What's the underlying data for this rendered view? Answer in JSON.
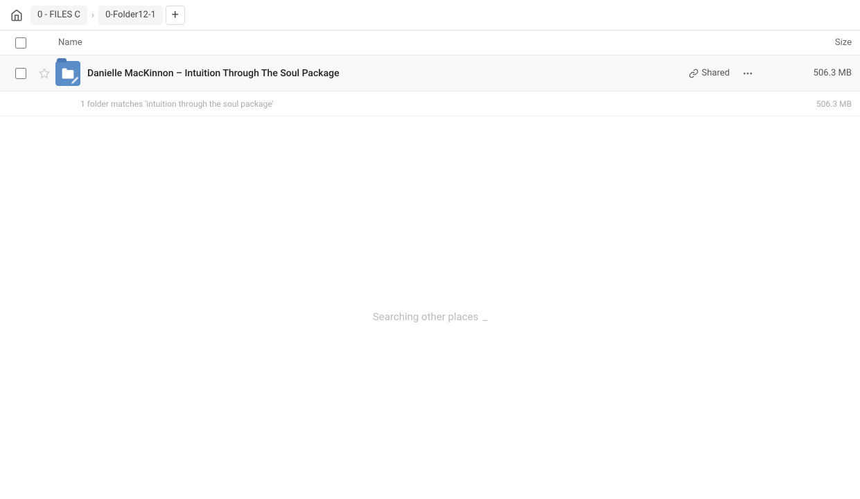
{
  "breadcrumb": {
    "home_label": "Home",
    "items": [
      {
        "label": "0 - FILES C"
      },
      {
        "label": "0-Folder12-1"
      }
    ],
    "add_label": "+"
  },
  "columns": {
    "name_label": "Name",
    "size_label": "Size"
  },
  "file_row": {
    "name": "Danielle MacKinnon – Intuition Through The Soul Package",
    "shared_label": "Shared",
    "size": "506.3 MB",
    "match_text": "1 folder matches 'intuition through the soul package'",
    "match_size": "506.3 MB"
  },
  "searching": {
    "text": "Searching other places"
  }
}
